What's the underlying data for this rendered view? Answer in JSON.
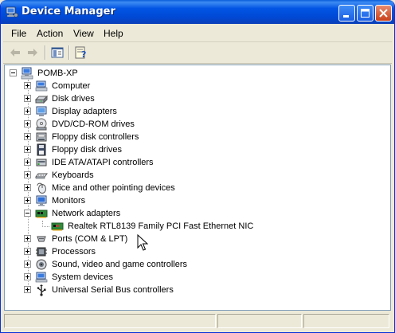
{
  "window": {
    "title": "Device Manager"
  },
  "title_buttons": {
    "minimize": "_",
    "maximize": "□",
    "close": "×"
  },
  "menu": [
    "File",
    "Action",
    "View",
    "Help"
  ],
  "toolbar": {
    "back_icon": "arrow-left-icon",
    "forward_icon": "arrow-right-icon",
    "show_hide_tree_icon": "console-tree-icon",
    "properties_icon": "properties-help-icon"
  },
  "tree": {
    "root": {
      "label": "POMB-XP",
      "icon": "computer-icon",
      "expanded": true
    },
    "items": [
      {
        "label": "Computer",
        "icon": "computer-icon",
        "expanded": false
      },
      {
        "label": "Disk drives",
        "icon": "disk-drive-icon",
        "expanded": false
      },
      {
        "label": "Display adapters",
        "icon": "display-adapter-icon",
        "expanded": false
      },
      {
        "label": "DVD/CD-ROM drives",
        "icon": "cdrom-icon",
        "expanded": false
      },
      {
        "label": "Floppy disk controllers",
        "icon": "floppy-controller-icon",
        "expanded": false
      },
      {
        "label": "Floppy disk drives",
        "icon": "floppy-drive-icon",
        "expanded": false
      },
      {
        "label": "IDE ATA/ATAPI controllers",
        "icon": "ide-controller-icon",
        "expanded": false
      },
      {
        "label": "Keyboards",
        "icon": "keyboard-icon",
        "expanded": false
      },
      {
        "label": "Mice and other pointing devices",
        "icon": "mouse-icon",
        "expanded": false
      },
      {
        "label": "Monitors",
        "icon": "monitor-icon",
        "expanded": false
      },
      {
        "label": "Network adapters",
        "icon": "network-adapter-icon",
        "expanded": true,
        "children": [
          {
            "label": "Realtek RTL8139 Family PCI Fast Ethernet NIC",
            "icon": "network-card-icon"
          }
        ]
      },
      {
        "label": "Ports (COM & LPT)",
        "icon": "port-icon",
        "expanded": false
      },
      {
        "label": "Processors",
        "icon": "processor-icon",
        "expanded": false
      },
      {
        "label": "Sound, video and game controllers",
        "icon": "sound-icon",
        "expanded": false
      },
      {
        "label": "System devices",
        "icon": "system-device-icon",
        "expanded": false
      },
      {
        "label": "Universal Serial Bus controllers",
        "icon": "usb-icon",
        "expanded": false
      }
    ]
  },
  "colors": {
    "titlebar": "#0255e4",
    "window_bg": "#ece9d8",
    "tree_bg": "#ffffff"
  }
}
